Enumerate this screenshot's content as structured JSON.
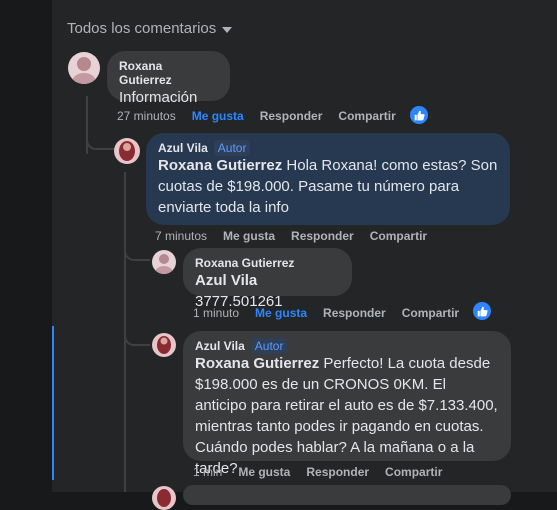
{
  "header": {
    "label": "Todos los comentarios"
  },
  "comments": [
    {
      "author": "Roxana Gutierrez",
      "text": "Información",
      "time": "27 minutos",
      "like": "Me gusta",
      "reply": "Responder",
      "share": "Compartir",
      "liked": true
    },
    {
      "author": "Azul Vila",
      "badge": "Autor",
      "mention": "Roxana Gutierrez",
      "text": "Hola Roxana! como estas? Son cuotas de $198.000. Pasame tu número para enviarte toda la info",
      "time": "7 minutos",
      "like": "Me gusta",
      "reply": "Responder",
      "share": "Compartir"
    },
    {
      "author": "Roxana Gutierrez",
      "mention": "Azul Vila",
      "text": "3777.501261",
      "time": "1 minuto",
      "like": "Me gusta",
      "reply": "Responder",
      "share": "Compartir",
      "liked": true
    },
    {
      "author": "Azul Vila",
      "badge": "Autor",
      "mention": "Roxana Gutierrez",
      "text": "Perfecto! La cuota desde $198.000 es de un CRONOS 0KM. El anticipo para retirar el auto es de $7.133.400, mientras tanto podes ir pagando en cuotas. Cuándo podes hablar? A la mañana o a la tarde?",
      "time": "1 min",
      "like": "Me gusta",
      "reply": "Responder",
      "share": "Compartir"
    }
  ],
  "colors": {
    "accent": "#2d86ff",
    "bubble": "#3a3b3c",
    "highlight_bubble": "#263951"
  }
}
